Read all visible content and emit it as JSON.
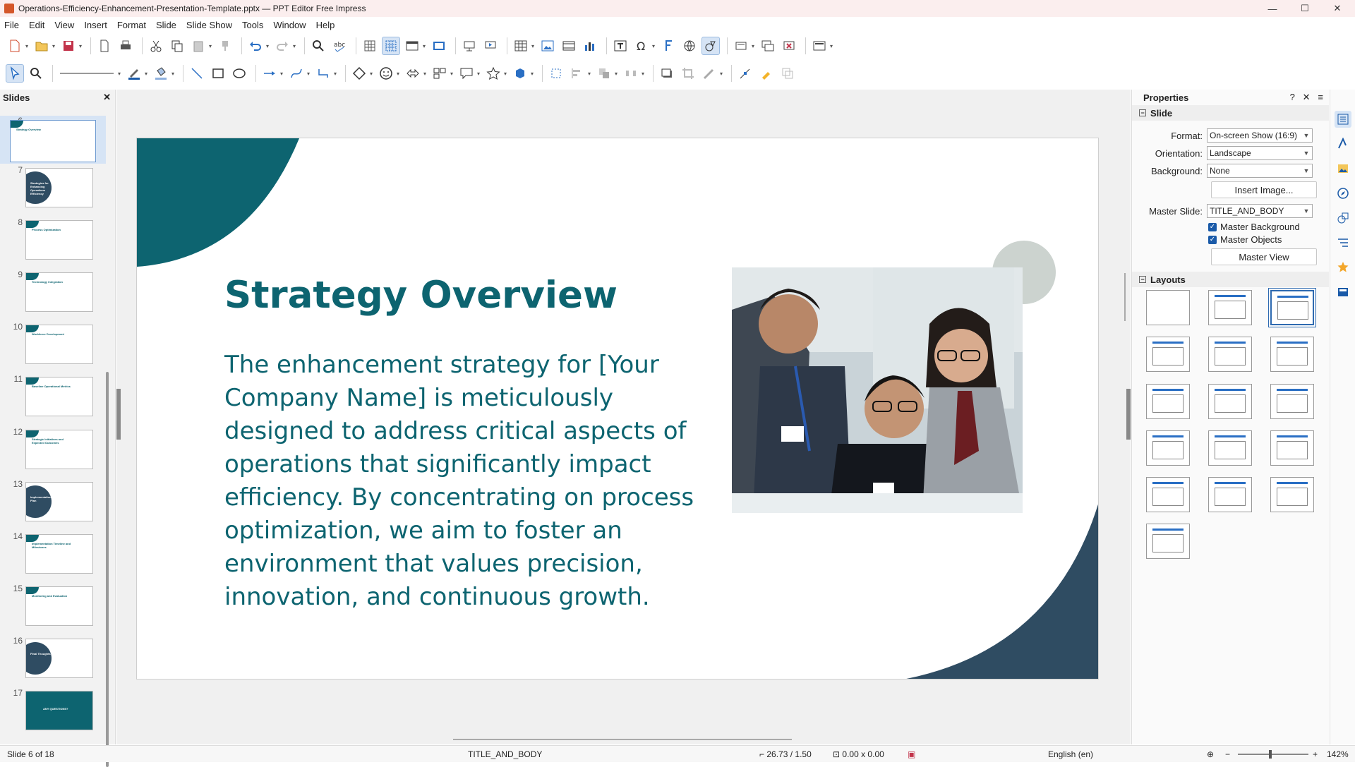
{
  "window": {
    "title": "Operations-Efficiency-Enhancement-Presentation-Template.pptx — PPT Editor Free Impress",
    "min": "—",
    "max": "☐",
    "close": "✕"
  },
  "menu": [
    "File",
    "Edit",
    "View",
    "Insert",
    "Format",
    "Slide",
    "Slide Show",
    "Tools",
    "Window",
    "Help"
  ],
  "slides_panel": {
    "title": "Slides",
    "close": "✕",
    "items": [
      {
        "num": "6",
        "caption": "Strategy Overview"
      },
      {
        "num": "7",
        "caption": "Strategies for Enhancing Operations Efficiency"
      },
      {
        "num": "8",
        "caption": "Process Optimization"
      },
      {
        "num": "9",
        "caption": "Technology Integration"
      },
      {
        "num": "10",
        "caption": "Workforce Development"
      },
      {
        "num": "11",
        "caption": "Baseline Operational Metrics"
      },
      {
        "num": "12",
        "caption": "Strategic Initiatives and Expected Outcomes"
      },
      {
        "num": "13",
        "caption": "Implementation Plan"
      },
      {
        "num": "14",
        "caption": "Implementation Timeline and Milestones"
      },
      {
        "num": "15",
        "caption": "Monitoring and Evaluation"
      },
      {
        "num": "16",
        "caption": "Final Thoughts"
      },
      {
        "num": "17",
        "caption": "ANY QUESTIONS?"
      }
    ]
  },
  "slide": {
    "title": "Strategy Overview",
    "body": "The enhancement strategy for [Your Company Name] is meticulously designed to address critical aspects of operations that significantly impact efficiency. By concentrating on process optimization, we aim to foster an environment that values precision, innovation, and continuous growth.",
    "colors": {
      "teal": "#0d6470",
      "navy": "#2f4c62",
      "circle": "#ccd3cf"
    }
  },
  "properties": {
    "title": "Properties",
    "help": "?",
    "close": "✕",
    "menu": "≡",
    "slide_section": "Slide",
    "format_label": "Format:",
    "format_value": "On-screen Show (16:9)",
    "orientation_label": "Orientation:",
    "orientation_value": "Landscape",
    "background_label": "Background:",
    "background_value": "None",
    "insert_image": "Insert Image...",
    "master_slide_label": "Master Slide:",
    "master_slide_value": "TITLE_AND_BODY",
    "master_background": "Master Background",
    "master_objects": "Master Objects",
    "master_view": "Master View",
    "layouts_section": "Layouts"
  },
  "status": {
    "slide": "Slide 6 of 18",
    "layout": "TITLE_AND_BODY",
    "position": "26.73 / 1.50",
    "size": "0.00 x 0.00",
    "language": "English (en)",
    "zoom": "142%"
  }
}
